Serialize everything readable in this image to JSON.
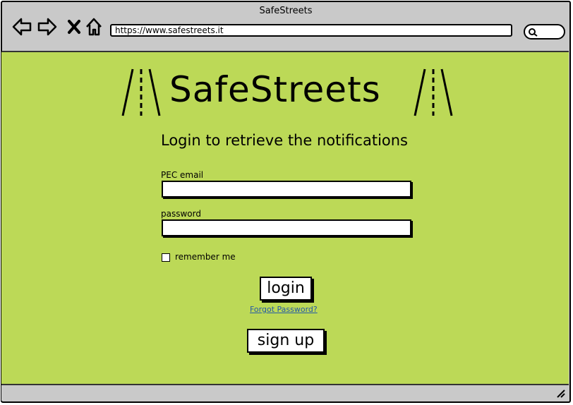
{
  "window": {
    "title": "SafeStreets"
  },
  "browser": {
    "url": "https://www.safestreets.it",
    "nav_icons": [
      "back-icon",
      "forward-icon",
      "close-icon",
      "home-icon"
    ],
    "search_icon": "search-icon"
  },
  "brand": {
    "name": "SafeStreets"
  },
  "login": {
    "heading": "Login to retrieve the notifications",
    "email_label": "PEC email",
    "email_value": "",
    "password_label": "password",
    "password_value": "",
    "remember_label": "remember me",
    "login_button": "login",
    "forgot_link": "Forgot Password?",
    "signup_button": "sign up"
  },
  "colors": {
    "content_bg": "#bcd957",
    "chrome_bg": "#c9c9c9",
    "link": "#2458a6"
  }
}
